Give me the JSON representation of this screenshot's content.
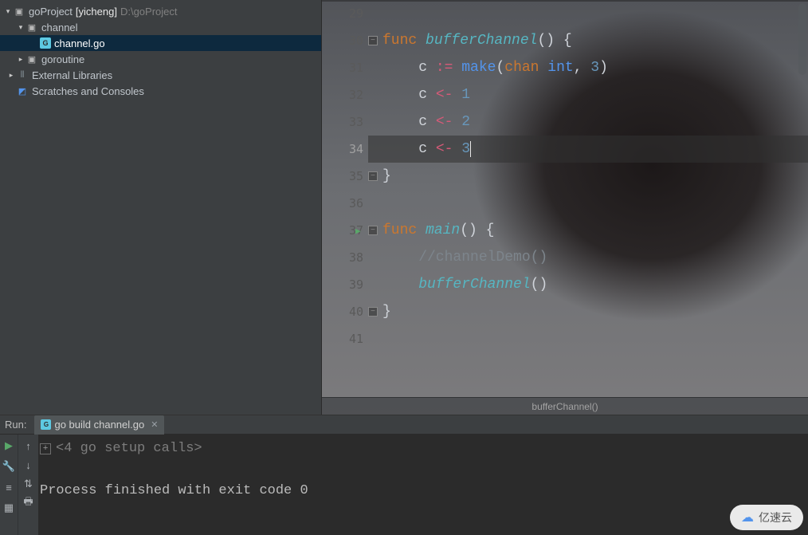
{
  "project_tree": {
    "root": {
      "label": "goProject",
      "bold": "[yicheng]",
      "dim": "D:\\goProject"
    },
    "channel": {
      "label": "channel"
    },
    "channel_go": {
      "label": "channel.go"
    },
    "goroutine": {
      "label": "goroutine"
    },
    "ext_libs": {
      "label": "External Libraries"
    },
    "scratches": {
      "label": "Scratches and Consoles"
    }
  },
  "editor": {
    "file": "channel.go",
    "sticky": "bufferChannel()",
    "lines": [
      {
        "n": 29,
        "tokens": []
      },
      {
        "n": 30,
        "tokens": [
          {
            "t": "func ",
            "c": "kw"
          },
          {
            "t": "bufferChannel",
            "c": "fn"
          },
          {
            "t": "()",
            "c": "par"
          },
          {
            "t": " {",
            "c": "id"
          }
        ],
        "block": true
      },
      {
        "n": 31,
        "tokens": [
          {
            "t": "    c ",
            "c": "id"
          },
          {
            "t": ":=",
            "c": "op"
          },
          {
            "t": " ",
            "c": "id"
          },
          {
            "t": "make",
            "c": "bi"
          },
          {
            "t": "(",
            "c": "par"
          },
          {
            "t": "chan ",
            "c": "ty"
          },
          {
            "t": "int",
            "c": "bi"
          },
          {
            "t": ", ",
            "c": "id"
          },
          {
            "t": "3",
            "c": "num"
          },
          {
            "t": ")",
            "c": "par"
          }
        ]
      },
      {
        "n": 32,
        "tokens": [
          {
            "t": "    c ",
            "c": "id"
          },
          {
            "t": "<-",
            "c": "op"
          },
          {
            "t": " ",
            "c": "id"
          },
          {
            "t": "1",
            "c": "num"
          }
        ]
      },
      {
        "n": 33,
        "tokens": [
          {
            "t": "    c ",
            "c": "id"
          },
          {
            "t": "<-",
            "c": "op"
          },
          {
            "t": " ",
            "c": "id"
          },
          {
            "t": "2",
            "c": "num"
          }
        ]
      },
      {
        "n": 34,
        "tokens": [
          {
            "t": "    c ",
            "c": "id"
          },
          {
            "t": "<-",
            "c": "op"
          },
          {
            "t": " ",
            "c": "id"
          },
          {
            "t": "3",
            "c": "num"
          }
        ],
        "active": true,
        "cursor": true
      },
      {
        "n": 35,
        "tokens": [
          {
            "t": "}",
            "c": "id"
          }
        ],
        "block": true
      },
      {
        "n": 36,
        "tokens": []
      },
      {
        "n": 37,
        "tokens": [
          {
            "t": "func ",
            "c": "kw"
          },
          {
            "t": "main",
            "c": "fn"
          },
          {
            "t": "()",
            "c": "par"
          },
          {
            "t": " {",
            "c": "id"
          }
        ],
        "block": true,
        "run": true
      },
      {
        "n": 38,
        "tokens": [
          {
            "t": "    //channelDemo()",
            "c": "cmt"
          }
        ]
      },
      {
        "n": 39,
        "tokens": [
          {
            "t": "    ",
            "c": "id"
          },
          {
            "t": "bufferChannel",
            "c": "fn"
          },
          {
            "t": "()",
            "c": "par"
          }
        ]
      },
      {
        "n": 40,
        "tokens": [
          {
            "t": "}",
            "c": "id"
          }
        ],
        "block": true
      },
      {
        "n": 41,
        "tokens": []
      }
    ]
  },
  "run_panel": {
    "title": "Run:",
    "tab": "go build channel.go",
    "console_head": "<4 go setup calls>",
    "console_body": "Process finished with exit code 0"
  },
  "watermark": "亿速云"
}
